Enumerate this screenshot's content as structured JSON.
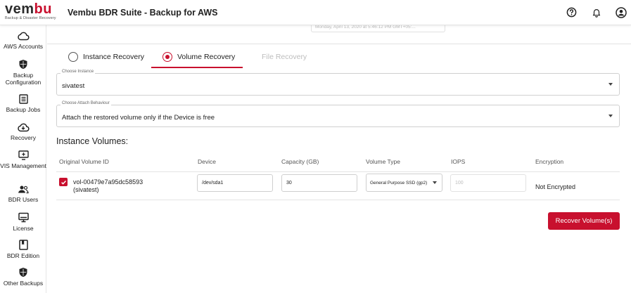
{
  "header": {
    "logo_main_prefix": "vem",
    "logo_main_accent": "bu",
    "logo_sub": "Backup & Disaster Recovery",
    "title": "Vembu BDR Suite - Backup for AWS",
    "icons": [
      "help-icon",
      "bell-icon",
      "account-icon"
    ]
  },
  "sidebar": {
    "items": [
      {
        "label": "AWS Accounts",
        "icon": "cloud-icon"
      },
      {
        "label": "Backup Configuration",
        "icon": "shield-icon"
      },
      {
        "label": "Backup Jobs",
        "icon": "list-icon"
      },
      {
        "label": "Recovery",
        "icon": "cloud-download-icon"
      },
      {
        "label": "VIS Management",
        "icon": "monitor-plus-icon"
      },
      {
        "label": "BDR Users",
        "icon": "users-icon"
      },
      {
        "label": "License",
        "icon": "desktop-icon"
      },
      {
        "label": "BDR Edition",
        "icon": "bookmark-icon"
      },
      {
        "label": "Other Backups",
        "icon": "shield-icon"
      }
    ]
  },
  "main": {
    "timestamp": "Monday, April 13, 2020 at 5:46:12 PM GMT+05:...",
    "tabs": [
      {
        "label": "Instance Recovery",
        "selected": false
      },
      {
        "label": "Volume Recovery",
        "selected": true
      },
      {
        "label": "File Recovery",
        "selected": false,
        "disabled": true
      }
    ],
    "choose_instance": {
      "label": "Choose Instance",
      "value": "sivatest"
    },
    "attach_behaviour": {
      "label": "Choose Attach Behaviour",
      "value": "Attach the restored volume only if the Device is free"
    },
    "section_title": "Instance Volumes:",
    "columns": [
      "Original Volume ID",
      "Device",
      "Capacity (GB)",
      "Volume Type",
      "IOPS",
      "Encryption"
    ],
    "rows": [
      {
        "checked": true,
        "volume_id": "vol-00479e7a95dc58593",
        "instance": "(sivatest)",
        "device": "/dev/sda1",
        "capacity": "30",
        "volume_type": "General Purpose SSD (gp2)",
        "iops": "100",
        "encryption": "Not Encrypted"
      }
    ],
    "recover_button": "Recover Volume(s)"
  },
  "colors": {
    "accent": "#c8102e",
    "text": "#222222",
    "muted": "#bdbdbd"
  }
}
